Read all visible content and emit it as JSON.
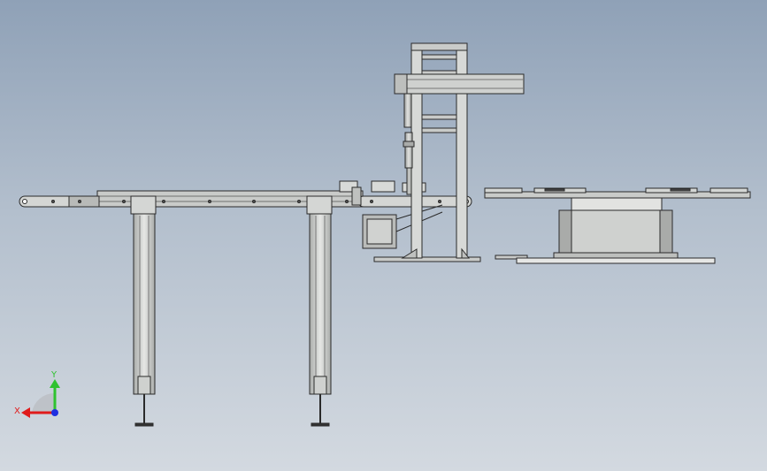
{
  "viewport": {
    "view": "front",
    "background_colors": [
      "#8fa1b7",
      "#d3d9e0"
    ]
  },
  "model": {
    "parts": [
      "conveyor-belt",
      "conveyor-leg-left",
      "conveyor-leg-right",
      "drive-motor",
      "gantry-frame",
      "gantry-crossbeam",
      "vertical-actuator",
      "rotary-table",
      "turntable-base",
      "base-plate"
    ],
    "colors": {
      "body": "#c9cbc9",
      "outline": "#2a2a2a",
      "shade": "#9ea19f",
      "highlight": "#e8e9e7"
    }
  },
  "triad": {
    "x_label": "X",
    "y_label": "Y",
    "x_color": "#e01b1b",
    "y_color": "#2fc22f",
    "z_color": "#1f2fe0"
  }
}
